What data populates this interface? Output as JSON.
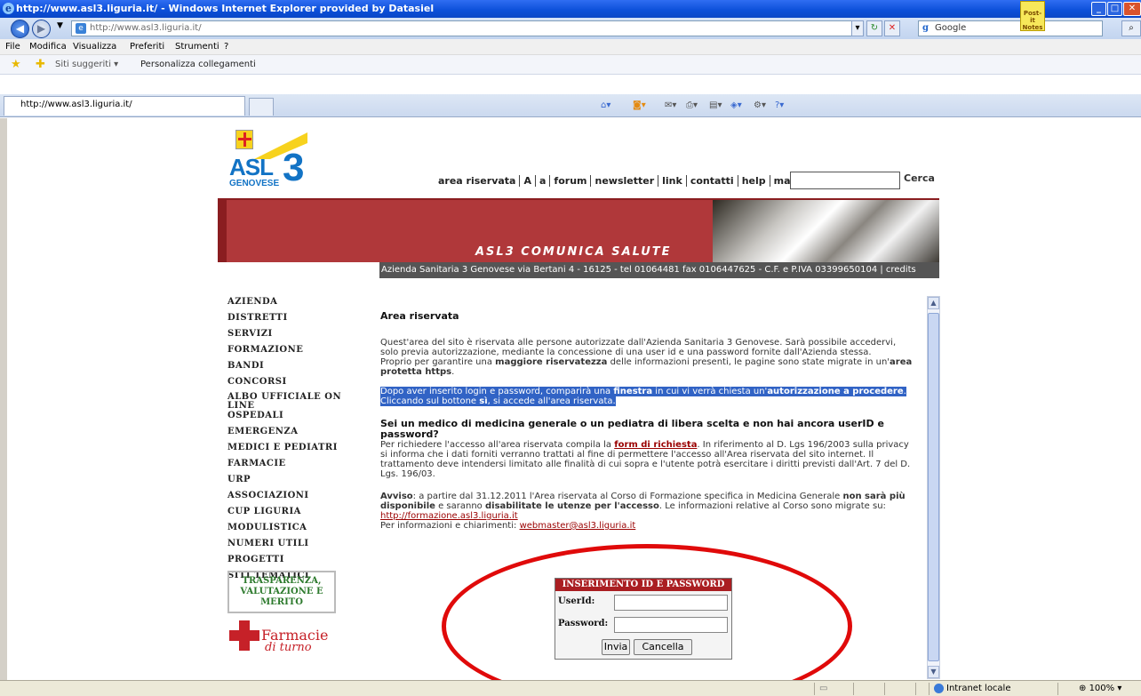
{
  "browser": {
    "title": "http://www.asl3.liguria.it/ - Windows Internet Explorer provided by Datasiel",
    "address": "http://www.asl3.liguria.it/",
    "search_engine": "Google",
    "postit": "Post-it Notes",
    "menu": [
      "File",
      "Modifica",
      "Visualizza",
      "Preferiti",
      "Strumenti",
      "?"
    ],
    "favorites": [
      "Siti suggeriti",
      "Personalizza collegamenti"
    ],
    "tab_title": "http://www.asl3.liguria.it/",
    "status_zone": "Intranet locale",
    "zoom": "100%"
  },
  "site": {
    "logo_text": "ASL",
    "logo_number": "3",
    "logo_sub": "GENOVESE",
    "topnav": [
      "area riservata",
      "A",
      "a",
      "forum",
      "newsletter",
      "link",
      "contatti",
      "help",
      "mappa"
    ],
    "search_button": "Cerca",
    "banner_claim": "ASL3 COMUNICA SALUTE",
    "address_line": "Azienda Sanitaria 3 Genovese via Bertani 4 - 16125 - tel 01064481 fax 0106447625 - C.F. e P.IVA 03399650104 | credits",
    "leftnav": [
      "AZIENDA",
      "DISTRETTI",
      "SERVIZI",
      "FORMAZIONE",
      "BANDI",
      "CONCORSI",
      "ALBO UFFICIALE ON LINE",
      "OSPEDALI",
      "EMERGENZA",
      "MEDICI E PEDIATRI",
      "FARMACIE",
      "URP",
      "ASSOCIAZIONI",
      "CUP LIGURIA",
      "MODULISTICA",
      "NUMERI UTILI",
      "PROGETTI",
      "SITI TEMATICI"
    ],
    "transparency": "TRASPARENZA, VALUTAZIONE E MERITO",
    "farmacie_main": "Farmacie",
    "farmacie_sub": "di turno"
  },
  "content": {
    "heading": "Area riservata",
    "p1": "Quest'area del sito è riservata alle persone autorizzate dall'Azienda Sanitaria 3 Genovese. Sarà possibile accedervi, solo previa autorizzazione, mediante la concessione di una user id e una password fornite dall'Azienda stessa.",
    "p2_a": "Proprio per garantire una ",
    "p2_b": "maggiore riservatezza",
    "p2_c": " delle informazioni presenti, le pagine sono state migrate in un'",
    "p2_d": "area protetta https",
    "p2_e": ".",
    "hl_a": "Dopo aver inserito login e password, comparirà una ",
    "hl_b": "finestra",
    "hl_c": " in cui vi verrà chiesta un'",
    "hl_d": "autorizzazione a procedere",
    "hl_e": ". Cliccando sul bottone ",
    "hl_f": "sì",
    "hl_g": ", si accede all'area riservata.",
    "q": "Sei un medico di medicina generale o un pediatra di libera scelta e non hai ancora userID e password?",
    "p3_a": "Per richiedere l'accesso all'area riservata compila la ",
    "p3_link": "form di richiesta",
    "p3_b": ". In riferimento al D. Lgs 196/2003 sulla privacy si informa che i dati forniti verranno trattati al fine di permettere l'accesso all'Area riservata del sito internet. Il trattamento deve intendersi limitato alle finalità di cui sopra e l'utente potrà esercitare i diritti previsti dall'Art. 7 del D. Lgs. 196/03.",
    "p4_a": "Avviso",
    "p4_b": ": a partire dal 31.12.2011 l'Area riservata al Corso di Formazione specifica in Medicina Generale ",
    "p4_c": "non sarà più disponibile",
    "p4_d": " e saranno ",
    "p4_e": "disabilitate le utenze per l'accesso",
    "p4_f": ". Le informazioni relative al Corso sono migrate su: ",
    "p4_link": "http://formazione.asl3.liguria.it",
    "p4_g": "Per informazioni e chiarimenti: ",
    "p4_mail": "webmaster@asl3.liguria.it"
  },
  "login": {
    "title": "INSERIMENTO ID E PASSWORD",
    "user_label": "UserId:",
    "password_label": "Password:",
    "submit": "Invia",
    "cancel": "Cancella"
  }
}
